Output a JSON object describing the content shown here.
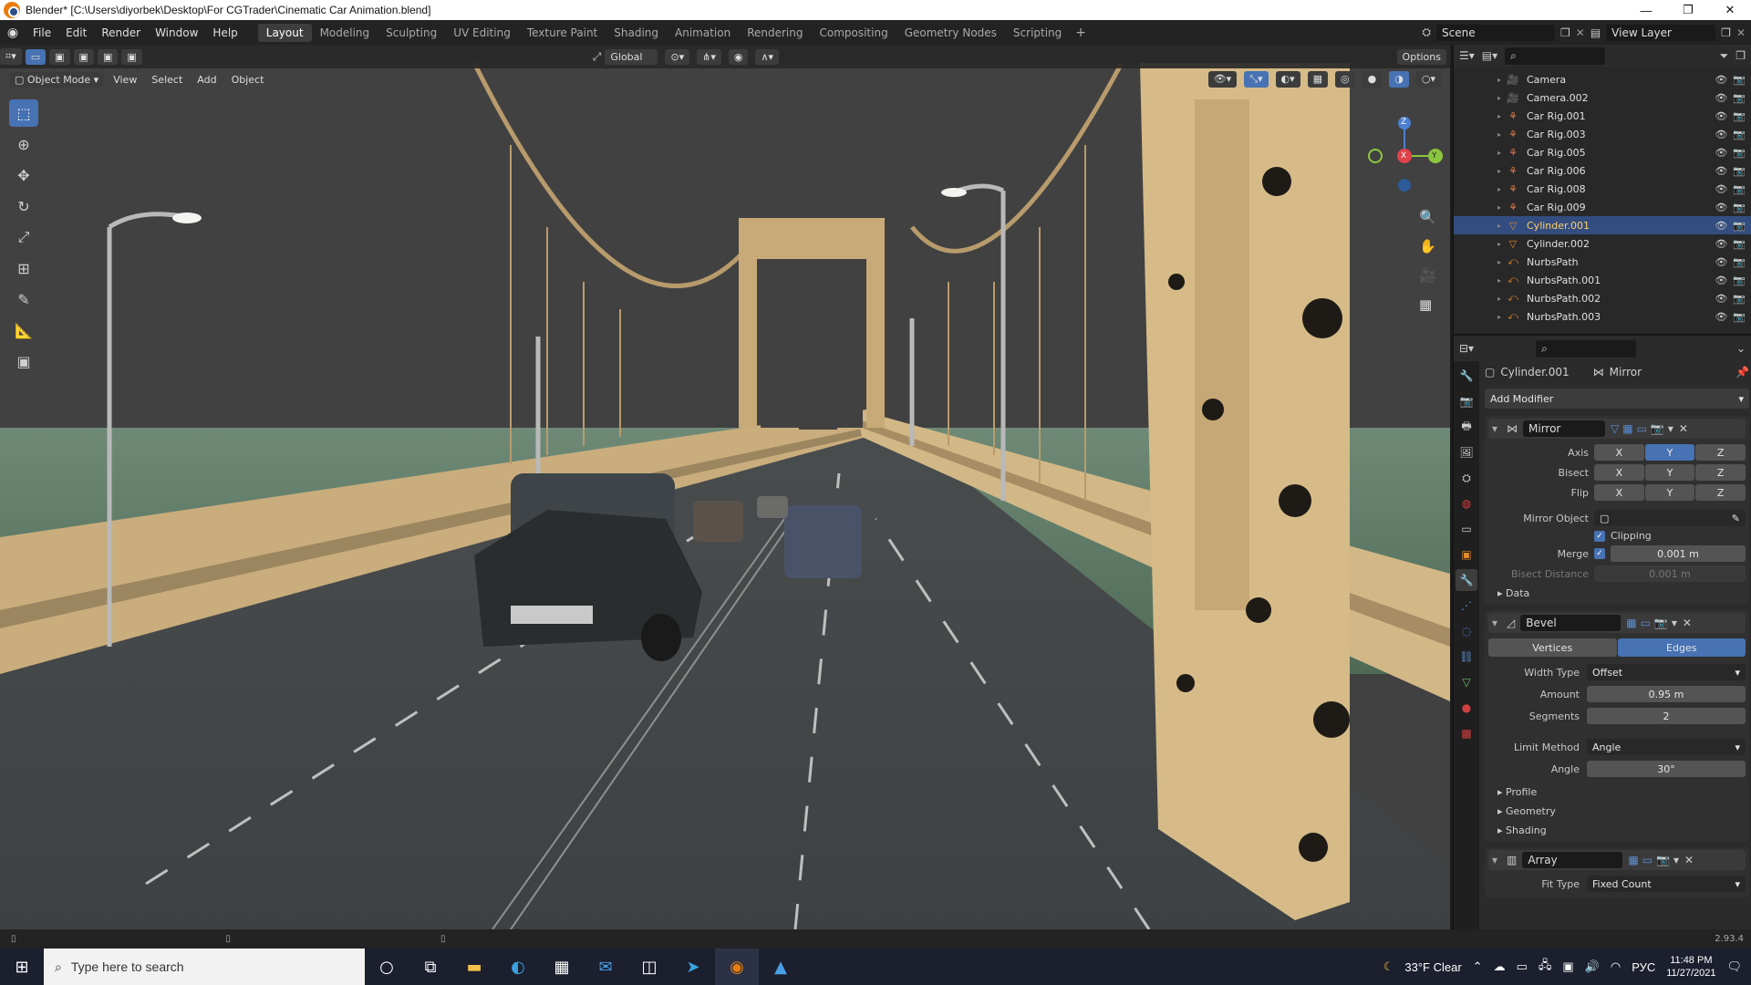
{
  "window": {
    "title": "Blender* [C:\\Users\\diyorbek\\Desktop\\For CGTrader\\Cinematic Car Animation.blend]",
    "min": "—",
    "max": "❐",
    "close": "✕"
  },
  "menu": [
    "File",
    "Edit",
    "Render",
    "Window",
    "Help"
  ],
  "workspaces": [
    "Layout",
    "Modeling",
    "Sculpting",
    "UV Editing",
    "Texture Paint",
    "Shading",
    "Animation",
    "Rendering",
    "Compositing",
    "Geometry Nodes",
    "Scripting"
  ],
  "scene": {
    "label": "Scene",
    "view_layer": "View Layer"
  },
  "viewport_header": {
    "transform": "Global",
    "options": "Options",
    "mode": "Object Mode",
    "menus": [
      "View",
      "Select",
      "Add",
      "Object"
    ]
  },
  "gizmo": {
    "x": "X",
    "y": "Y",
    "z": "Z"
  },
  "outliner": {
    "items": [
      {
        "name": "Camera",
        "type": "camera"
      },
      {
        "name": "Camera.002",
        "type": "camera"
      },
      {
        "name": "Car Rig.001",
        "type": "armature"
      },
      {
        "name": "Car Rig.003",
        "type": "armature"
      },
      {
        "name": "Car Rig.005",
        "type": "armature"
      },
      {
        "name": "Car Rig.006",
        "type": "armature"
      },
      {
        "name": "Car Rig.008",
        "type": "armature"
      },
      {
        "name": "Car Rig.009",
        "type": "armature"
      },
      {
        "name": "Cylinder.001",
        "type": "mesh",
        "selected": true
      },
      {
        "name": "Cylinder.002",
        "type": "mesh"
      },
      {
        "name": "NurbsPath",
        "type": "curve"
      },
      {
        "name": "NurbsPath.001",
        "type": "curve"
      },
      {
        "name": "NurbsPath.002",
        "type": "curve"
      },
      {
        "name": "NurbsPath.003",
        "type": "curve"
      }
    ]
  },
  "properties": {
    "object": "Cylinder.001",
    "modifier_context": "Mirror",
    "add_modifier": "Add Modifier",
    "mirror": {
      "name": "Mirror",
      "axis_label": "Axis",
      "bisect_label": "Bisect",
      "flip_label": "Flip",
      "x": "X",
      "y": "Y",
      "z": "Z",
      "mirror_object_label": "Mirror Object",
      "clipping_label": "Clipping",
      "merge_label": "Merge",
      "merge_value": "0.001 m",
      "bisect_distance_label": "Bisect Distance",
      "bisect_distance_value": "0.001 m",
      "data_label": "Data"
    },
    "bevel": {
      "name": "Bevel",
      "vertices": "Vertices",
      "edges": "Edges",
      "width_type_label": "Width Type",
      "width_type": "Offset",
      "amount_label": "Amount",
      "amount": "0.95 m",
      "segments_label": "Segments",
      "segments": "2",
      "limit_method_label": "Limit Method",
      "limit_method": "Angle",
      "angle_label": "Angle",
      "angle": "30°",
      "profile": "Profile",
      "geometry": "Geometry",
      "shading": "Shading"
    },
    "array": {
      "name": "Array",
      "fit_type_label": "Fit Type",
      "fit_type": "Fixed Count"
    }
  },
  "status": {
    "version": "2.93.4"
  },
  "taskbar": {
    "search_placeholder": "Type here to search",
    "weather": "33°F  Clear",
    "lang": "РУС",
    "time": "11:48 PM",
    "date": "11/27/2021"
  }
}
